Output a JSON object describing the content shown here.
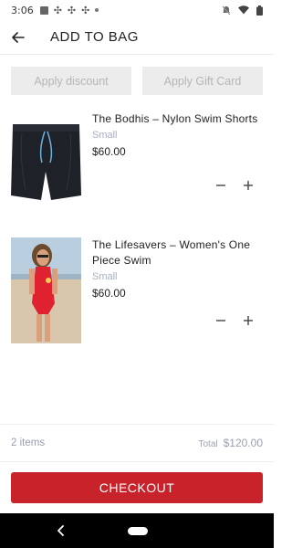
{
  "status_bar": {
    "time": "3:06"
  },
  "header": {
    "title": "ADD TO BAG",
    "back_icon": "arrow-left-icon"
  },
  "discount": {
    "apply_discount_label": "Apply discount",
    "apply_gift_card_label": "Apply Gift Card"
  },
  "cart": {
    "items": [
      {
        "name": "The Bodhis – Nylon Swim Shorts",
        "size": "Small",
        "price": "$60.00"
      },
      {
        "name": "The Lifesavers – Women's One Piece Swim",
        "size": "Small",
        "price": "$60.00"
      }
    ]
  },
  "summary": {
    "items_count": "2 items",
    "total_label": "Total",
    "total_value": "$120.00"
  },
  "checkout": {
    "label": "CHECKOUT"
  },
  "colors": {
    "accent": "#c8232b",
    "muted": "#a7aec0"
  }
}
